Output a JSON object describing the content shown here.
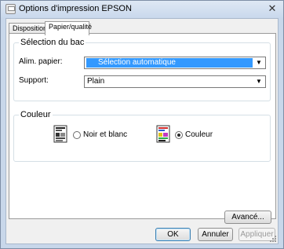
{
  "window": {
    "title": "Options d'impression EPSON",
    "close_glyph": "✕"
  },
  "tabs": [
    {
      "label": "Disposition",
      "active": false
    },
    {
      "label": "Papier/qualité",
      "active": true
    }
  ],
  "tray_group": {
    "title": "Sélection du bac",
    "paper_source_label": "Alim. papier:",
    "paper_source_value": "Sélection automatique",
    "media_label": "Support:",
    "media_value": "Plain"
  },
  "color_group": {
    "title": "Couleur",
    "options": [
      {
        "label": "Noir et blanc",
        "checked": false,
        "icon": "grayscale-document-icon"
      },
      {
        "label": "Couleur",
        "checked": true,
        "icon": "color-document-icon"
      }
    ]
  },
  "buttons": {
    "advanced": "Avancé...",
    "ok": "OK",
    "cancel": "Annuler",
    "apply": "Appliquer"
  },
  "colors": {
    "selection": "#3399ff",
    "frame": "#c8d7ea",
    "client_bg": "#f0f0f0"
  }
}
